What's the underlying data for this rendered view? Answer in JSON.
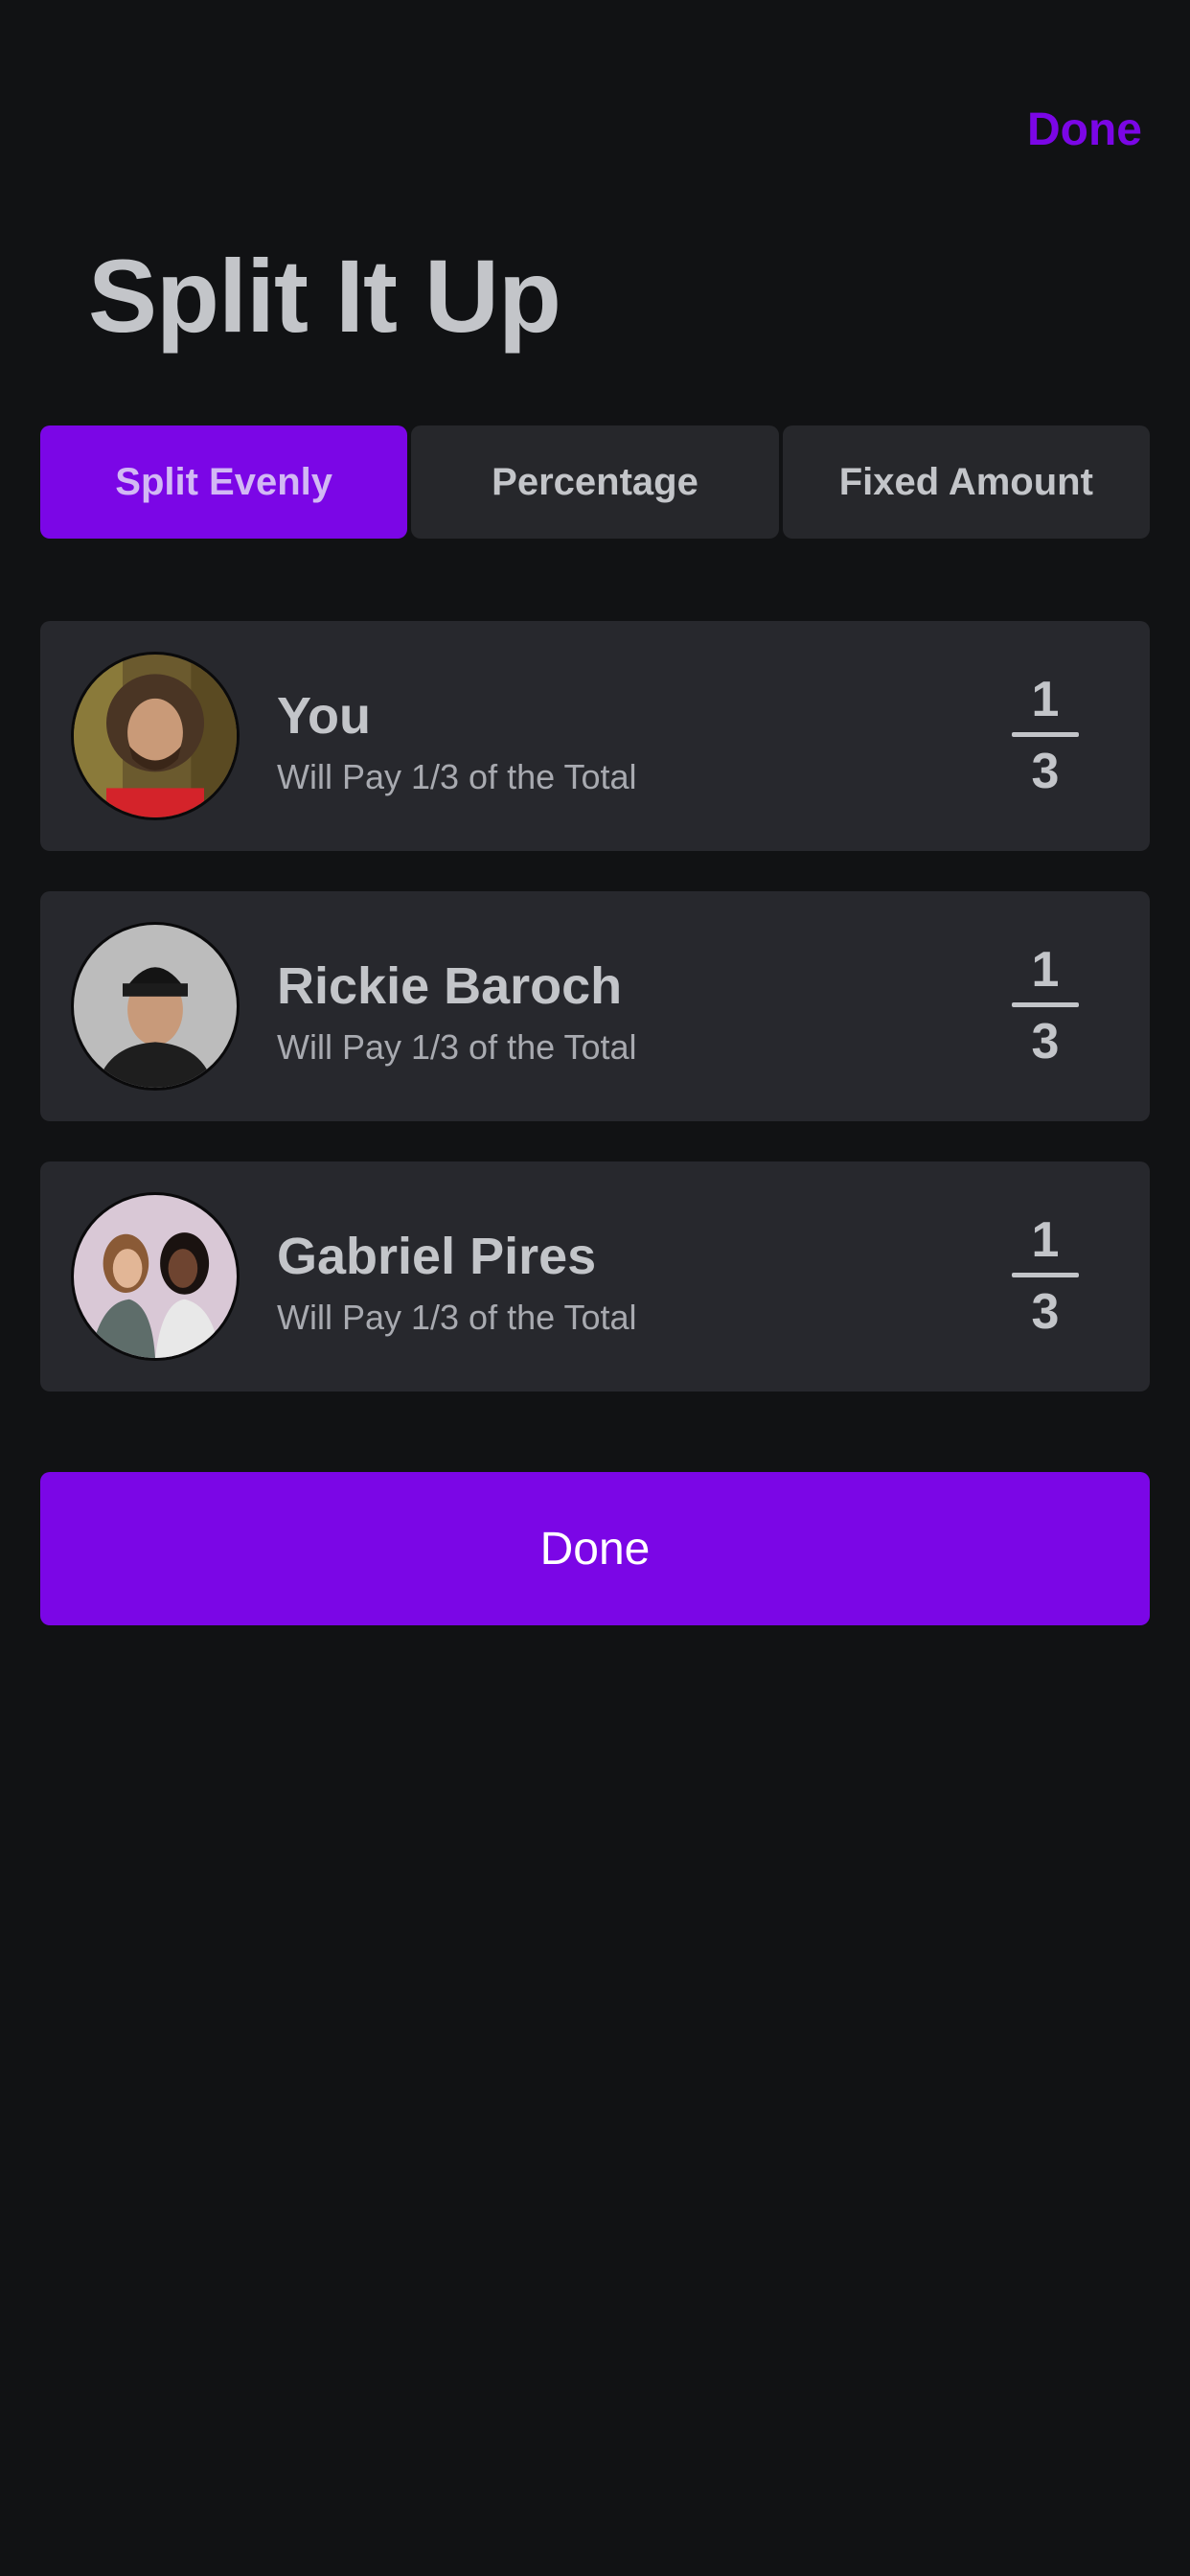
{
  "header": {
    "done_label": "Done",
    "title": "Split It Up"
  },
  "split_modes": [
    {
      "label": "Split Evenly",
      "selected": true
    },
    {
      "label": "Percentage",
      "selected": false
    },
    {
      "label": "Fixed Amount",
      "selected": false
    }
  ],
  "participants": [
    {
      "name": "You",
      "subtitle": "Will Pay 1/3 of the Total",
      "share_numerator": "1",
      "share_denominator": "3",
      "avatar": "man-curly-hair-photo"
    },
    {
      "name": "Rickie Baroch",
      "subtitle": "Will Pay 1/3 of the Total",
      "share_numerator": "1",
      "share_denominator": "3",
      "avatar": "man-beanie-photo"
    },
    {
      "name": "Gabriel Pires",
      "subtitle": "Will Pay 1/3 of the Total",
      "share_numerator": "1",
      "share_denominator": "3",
      "avatar": "two-women-photo"
    }
  ],
  "footer": {
    "done_label": "Done"
  },
  "colors": {
    "accent": "#7b06e6",
    "background": "#111214",
    "card": "#27282d"
  }
}
